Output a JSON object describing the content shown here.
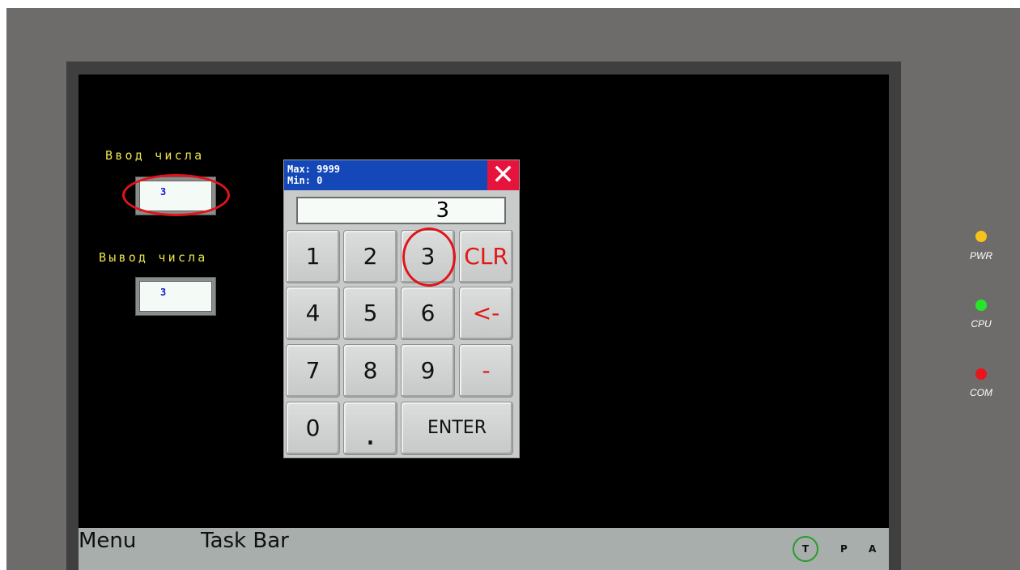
{
  "screen": {
    "input_caption": "Ввод числа",
    "input_value": "3",
    "output_caption": "Вывод числа",
    "output_value": "3"
  },
  "keypad": {
    "max_label": "Max: 9999",
    "min_label": "Min: 0",
    "close_glyph": "✕",
    "display_value": "3",
    "keys": {
      "k1": "1",
      "k2": "2",
      "k3": "3",
      "clr": "CLR",
      "k4": "4",
      "k5": "5",
      "k6": "6",
      "back": "<-",
      "k7": "7",
      "k8": "8",
      "k9": "9",
      "minus": "-",
      "k0": "0",
      "dot": ".",
      "enter": "ENTER"
    }
  },
  "taskbar": {
    "menu": "Menu",
    "task_bar": "Task Bar",
    "t": "T",
    "p": "P",
    "a": "A"
  },
  "leds": [
    {
      "label": "PWR",
      "color": "#f7c21b"
    },
    {
      "label": "CPU",
      "color": "#27e629"
    },
    {
      "label": "COM",
      "color": "#e9141c"
    }
  ],
  "colors": {
    "caption_yellow": "#e7e34a",
    "value_blue": "#1414d8",
    "keypad_header_blue": "#1448b8",
    "close_red": "#e6143c",
    "highlight_ring_red": "#e0141c"
  }
}
